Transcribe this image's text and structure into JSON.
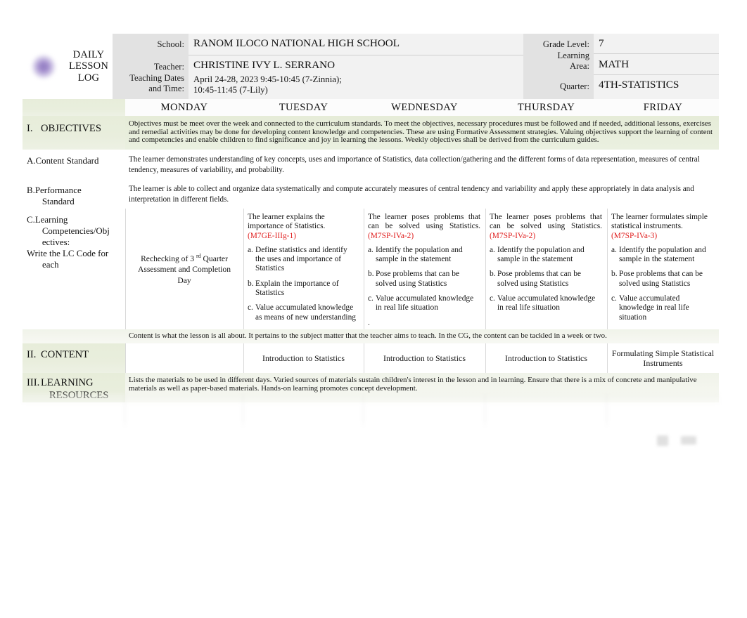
{
  "document": {
    "title": "DAILY LESSON LOG",
    "title_lines": [
      "DAILY",
      "LESSON",
      "LOG"
    ]
  },
  "header": {
    "labels": {
      "school": "School:",
      "teacher": "Teacher:",
      "teaching_dates": "Teaching Dates",
      "and_time": "and Time:",
      "grade_level": "Grade Level:",
      "learning": "Learning",
      "area": "Area:",
      "quarter": "Quarter:"
    },
    "values": {
      "school": "RANOM ILOCO NATIONAL HIGH SCHOOL",
      "teacher": "CHRISTINE IVY L. SERRANO",
      "teaching_dates": "April 24-28, 2023 9:45-10:45 (7-Zinnia); 10:45-11:45 (7-Lily)",
      "grade_level": "7",
      "learning_area": "MATH",
      "quarter": "4TH-STATISTICS"
    }
  },
  "days": [
    "MONDAY",
    "TUESDAY",
    "WEDNESDAY",
    "THURSDAY",
    "FRIDAY"
  ],
  "sections": {
    "objectives": {
      "numeral": "I.",
      "label": "OBJECTIVES",
      "note": "Objectives must be meet over the week and connected to the curriculum standards. To meet the objectives, necessary procedures must be followed and if needed, additional lessons, exercises and remedial activities may be done for developing content knowledge and competencies. These are using Formative Assessment strategies. Valuing objectives support the learning of content and competencies and enable children to find significance and joy in learning the lessons. Weekly objectives shall be derived from the curriculum guides."
    },
    "content_standard": {
      "label_a": "A.",
      "label": "Content Standard",
      "text": "The learner demonstrates understanding of key concepts, uses and importance of Statistics, data collection/gathering and the different forms of data representation, measures of central tendency, measures of variability, and probability."
    },
    "performance_standard": {
      "label_b": "B.",
      "label_line1": "Performance",
      "label_line2": "Standard",
      "text": "The learner is able to collect and organize data systematically and compute accurately measures of central tendency and variability and apply these appropriately in data analysis and interpretation in different fields."
    },
    "learning_competencies": {
      "label_c": "C.",
      "label_line1": "Learning",
      "label_line2": "Competencies/Obj",
      "label_line3": "ectives:",
      "label_line4": "Write the LC Code for",
      "label_line5": "each",
      "monday": {
        "note_pre": "Rechecking of 3",
        "note_sup": "rd",
        "note_post": "Quarter Assessment and Completion Day"
      },
      "tuesday": {
        "lead": "The learner explains the importance of Statistics.",
        "code": "(M7GE-IIIg-1)",
        "items": [
          {
            "bullet": "a.",
            "text": "Define statistics and identify the uses and importance of Statistics"
          },
          {
            "bullet": "b.",
            "text": "Explain the importance of Statistics"
          },
          {
            "bullet": "c.",
            "text": "Value accumulated knowledge as means of new understanding"
          }
        ]
      },
      "wednesday": {
        "lead": "The learner poses problems that can be solved using Statistics.",
        "code": "(M7SP-IVa-2)",
        "items": [
          {
            "bullet": "a.",
            "text": "Identify the population and sample in the statement"
          },
          {
            "bullet": "b.",
            "text": "Pose problems that can be solved using Statistics"
          },
          {
            "bullet": "c.",
            "text": "Value accumulated knowledge in real life situation"
          }
        ],
        "trailing": "."
      },
      "thursday": {
        "lead": "The learner poses problems that can be solved using Statistics.",
        "code": "(M7SP-IVa-2)",
        "items": [
          {
            "bullet": "a.",
            "text": "Identify the population and sample in the statement"
          },
          {
            "bullet": "b.",
            "text": "Pose problems that can be solved using Statistics"
          },
          {
            "bullet": "c.",
            "text": "Value accumulated knowledge in real life situation"
          }
        ]
      },
      "friday": {
        "lead": "The learner formulates simple statistical instruments.",
        "code": "(M7SP-IVa-3)",
        "items": [
          {
            "bullet": "a.",
            "text": "Identify the population and sample in the statement"
          },
          {
            "bullet": "b.",
            "text": "Pose problems that can be solved using Statistics"
          },
          {
            "bullet": "c.",
            "text": "Value accumulated knowledge in real life situation"
          }
        ]
      }
    },
    "content": {
      "numeral": "II.",
      "label": "CONTENT",
      "note": "Content is what the lesson is all about. It pertains to the subject matter that the teacher aims to teach. In the CG, the content can be tackled in a week or two.",
      "monday": "",
      "tuesday": "Introduction to Statistics",
      "wednesday": "Introduction to Statistics",
      "thursday": "Introduction to Statistics",
      "friday": "Formulating Simple Statistical Instruments"
    },
    "learning_resources": {
      "numeral": "III.",
      "label_line1": "LEARNING",
      "label_line2": "RESOURCES",
      "note": "Lists the materials to be used in different days. Varied sources of materials sustain children's interest in the lesson and in learning. Ensure that there is a mix of concrete and manipulative materials as well as paper-based materials. Hands-on learning promotes concept development."
    }
  },
  "colors": {
    "code_red": "#e02020",
    "label_tint": "#e8eedc",
    "header_label_bg": "#e2e2e2",
    "header_value_bg": "#f2f2f2"
  }
}
